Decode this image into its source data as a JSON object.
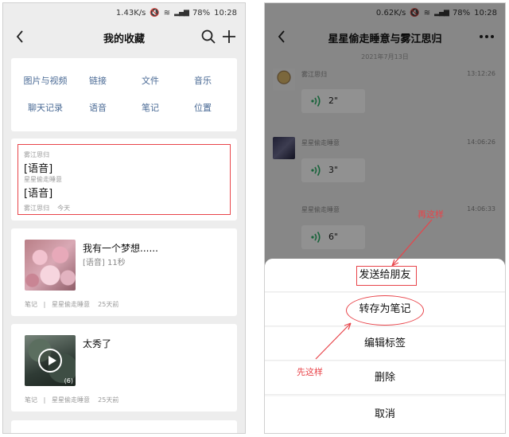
{
  "left": {
    "status": {
      "speed": "1.43K/s",
      "battery": "78%",
      "time": "10:28"
    },
    "title": "我的收藏",
    "categories": [
      "图片与视频",
      "链接",
      "文件",
      "音乐",
      "聊天记录",
      "语音",
      "笔记",
      "位置"
    ],
    "voice_card": {
      "sender1": "雾江思归",
      "text1": "[语音]",
      "sender2": "星星偷走睡意",
      "text2": "[语音]",
      "meta_source": "雾江思归",
      "meta_time": "今天"
    },
    "items": [
      {
        "title": "我有一个梦想......",
        "subtitle": "[语音] 11秒",
        "meta_type": "笔记",
        "meta_sep": "|",
        "meta_source": "星星偷走睡意",
        "meta_time": "25天前"
      },
      {
        "title": "太秀了",
        "video_count": "(6)",
        "meta_type": "笔记",
        "meta_sep": "|",
        "meta_source": "星星偷走睡意",
        "meta_time": "25天前"
      }
    ]
  },
  "right": {
    "status": {
      "speed": "0.62K/s",
      "battery": "78%",
      "time": "10:28"
    },
    "title": "星星偷走睡意与雾江思归",
    "date": "2021年7月13日",
    "messages": [
      {
        "name": "雾江思归",
        "time": "13:12:26",
        "duration": "2\""
      },
      {
        "name": "星星偷走睡意",
        "time": "14:06:26",
        "duration": "3\""
      },
      {
        "name": "星星偷走睡意",
        "time": "14:06:33",
        "duration": "6\""
      }
    ],
    "sheet": {
      "send": "发送给朋友",
      "save_note": "转存为笔记",
      "edit_tags": "编辑标签",
      "delete": "删除",
      "cancel": "取消"
    },
    "annotations": {
      "then": "再这样",
      "first": "先这样"
    }
  },
  "accent_color": "#e8444a",
  "voice_icon_color": "#2aae67"
}
